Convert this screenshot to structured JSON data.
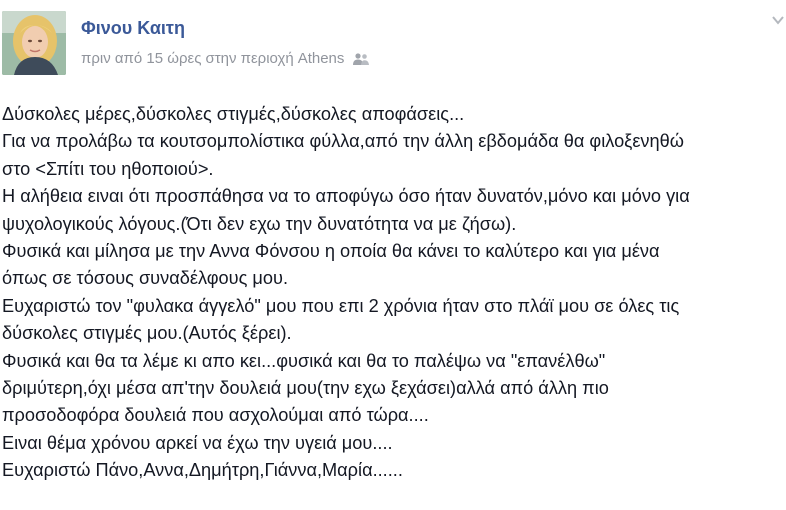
{
  "post": {
    "author_name": "Φινου Καιτη",
    "time_text": "πριν από 15 ώρες",
    "location_prefix": "στην περιοχή",
    "location_name": "Athens",
    "privacy_icon": "friends-icon",
    "menu_icon": "chevron-down-icon",
    "lines": [
      "Δύσκολες μέρες,δύσκολες στιγμές,δύσκολες αποφάσεις...",
      "Για να προλάβω τα κουτσομπολίστικα φύλλα,από την άλλη εβδομάδα θα φιλοξενηθώ",
      "στο <Σπίτι του ηθοποιού>.",
      "Η αλήθεια ειναι ότι προσπάθησα να το αποφύγω όσο ήταν δυνατόν,μόνο και μόνο για",
      "ψυχολογικούς λόγους.(Ότι δεν εχω την δυνατότητα να με ζήσω).",
      "Φυσικά και μίλησα με την Αννα Φόνσου η οποία θα κάνει το καλύτερο και για μένα",
      "όπως σε τόσους συναδέλφους μου.",
      "Ευχαριστώ τον \"φυλακα άγγελό\" μου που επι 2 χρόνια ήταν στο πλάϊ μου σε όλες τις",
      "δύσκολες στιγμές μου.(Αυτός ξέρει).",
      "Φυσικά και θα τα λέμε κι απο κει...φυσικά και θα το παλέψω να \"επανέλθω\"",
      "δριμύτερη,όχι μέσα απ'την δουλειά μου(την εχω ξεχάσει)αλλά από άλλη πιο",
      "προσοδοφόρα δουλειά που ασχολούμαι από τώρα....",
      "Ειναι θέμα χρόνου αρκεί να έχω την υγειά μου....",
      "Ευχαριστώ Πάνο,Αννα,Δημήτρη,Γιάννα,Μαρία......"
    ]
  }
}
